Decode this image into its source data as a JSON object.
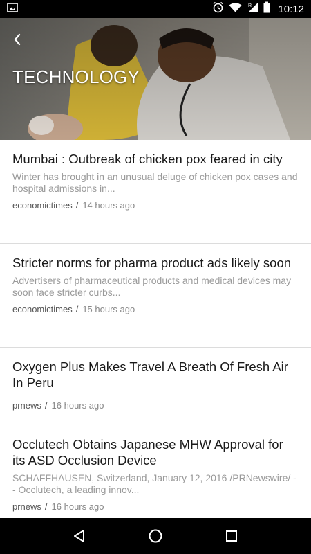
{
  "status_bar": {
    "time": "10:12",
    "icons": [
      "image-icon",
      "alarm-icon",
      "wifi-icon",
      "signal-icon",
      "battery-icon"
    ]
  },
  "header": {
    "title": "TECHNOLOGY",
    "back_icon": "back-arrow-icon"
  },
  "articles": [
    {
      "title": "Mumbai : Outbreak of chicken pox feared in city",
      "summary": "Winter has brought in an unusual deluge of chicken pox cases and hospital admissions in...",
      "source": "economictimes",
      "separator": "/",
      "time": "14 hours ago"
    },
    {
      "title": "Stricter norms for pharma product ads likely soon",
      "summary": "Advertisers of pharmaceutical products and medical devices may soon face stricter curbs...",
      "source": "economictimes",
      "separator": "/",
      "time": "15 hours ago"
    },
    {
      "title": "Oxygen Plus Makes Travel A Breath Of Fresh Air In Peru",
      "summary": "",
      "source": "prnews",
      "separator": "/",
      "time": "16 hours ago"
    },
    {
      "title": "Occlutech Obtains Japanese MHW Approval for its ASD Occlusion Device",
      "summary": "SCHAFFHAUSEN, Switzerland, January 12, 2016 /PRNewswire/ -- Occlutech, a leading innov...",
      "source": "prnews",
      "separator": "/",
      "time": "16 hours ago"
    }
  ],
  "nav_bar": {
    "icons": [
      "back-triangle-icon",
      "home-circle-icon",
      "recents-square-icon"
    ]
  },
  "colors": {
    "status_bar_bg": "#000000",
    "nav_bar_bg": "#000000",
    "title_text": "#1a1a1a",
    "summary_text": "#9a9a9a",
    "divider": "#dcdcdc"
  }
}
